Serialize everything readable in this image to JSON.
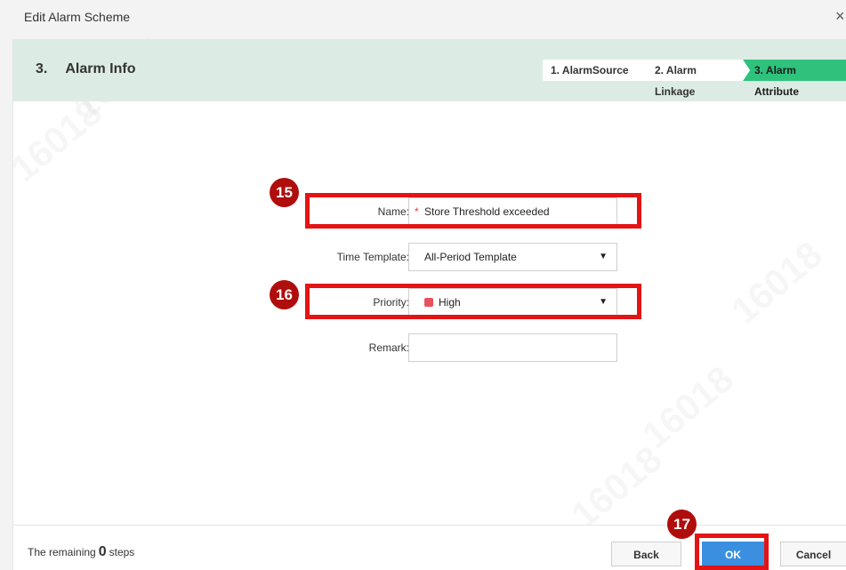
{
  "window": {
    "title": "Edit Alarm Scheme",
    "close_glyph": "×"
  },
  "header": {
    "step_number": "3.",
    "step_title": "Alarm Info",
    "steps": [
      "1. AlarmSource",
      "2. Alarm Linkage",
      "3. Alarm Attribute"
    ],
    "active_step": 2
  },
  "form": {
    "name": {
      "label": "Name:",
      "required_mark": "*",
      "value": "Store Threshold exceeded"
    },
    "time_template": {
      "label": "Time Template:",
      "value": "All-Period Template"
    },
    "priority": {
      "label": "Priority:",
      "value": "High",
      "color": "#e8525d"
    },
    "remark": {
      "label": "Remark:",
      "value": ""
    }
  },
  "annotations": {
    "badge_15": "15",
    "badge_16": "16",
    "badge_17": "17"
  },
  "footer": {
    "remaining_prefix": "The remaining",
    "remaining_count": "0",
    "remaining_suffix": "steps",
    "back_label": "Back",
    "ok_label": "OK",
    "cancel_label": "Cancel"
  },
  "watermark_text": "16018",
  "colors": {
    "accent": "#3a8fe0",
    "active_step": "#2fc27d",
    "highlight": "#e41414",
    "badge": "#b00d0d"
  }
}
